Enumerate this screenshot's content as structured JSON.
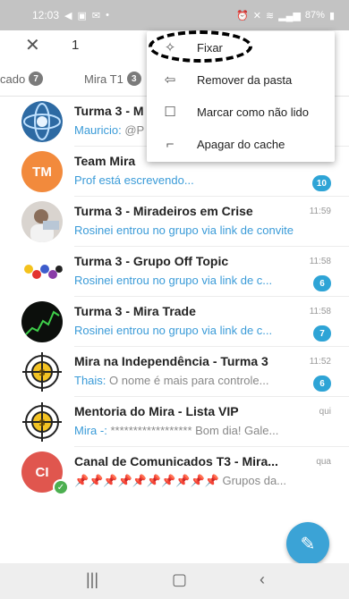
{
  "status_bar": {
    "time": "12:03",
    "left_icons": [
      "telegram-send-icon",
      "gallery-icon",
      "mail-icon",
      "dot-icon"
    ],
    "right_icons": [
      "alarm-icon",
      "mute-icon",
      "wifi-icon",
      "signal-icon"
    ],
    "battery": "87%"
  },
  "topbar": {
    "close_label": "✕",
    "selected_count": "1"
  },
  "tabs": [
    {
      "label": "cado",
      "badge": "7"
    },
    {
      "label": "Mira T1",
      "badge": "3"
    }
  ],
  "context_menu": {
    "items": [
      {
        "label": "Fixar",
        "icon": "pin-icon"
      },
      {
        "label": "Remover da pasta",
        "icon": "folder-remove-icon"
      },
      {
        "label": "Marcar como não lido",
        "icon": "mark-unread-icon"
      },
      {
        "label": "Apagar do cache",
        "icon": "broom-icon"
      }
    ]
  },
  "chats": [
    {
      "name": "Turma 3 - M",
      "sender": "Mauricio: ",
      "text": "@P",
      "time": "",
      "count": "",
      "avatar": "globe-avatar"
    },
    {
      "name": "Team Mira",
      "sender": "",
      "text": "Prof está escrevendo...",
      "time": "",
      "count": "10",
      "avatar_initials": "TM"
    },
    {
      "name": "Turma 3 - Miradeiros em Crise",
      "sender": "",
      "text": "Rosinei entrou no grupo via link de convite",
      "time": "11:59",
      "count": "",
      "avatar": "photo-avatar"
    },
    {
      "name": "Turma 3 - Grupo Off Topic",
      "sender": "",
      "text": "Rosinei entrou no grupo via link de c...",
      "time": "11:58",
      "count": "6",
      "avatar": "photo-avatar"
    },
    {
      "name": "Turma 3 - Mira Trade",
      "sender": "",
      "text": "Rosinei entrou no grupo via link de c...",
      "time": "11:58",
      "count": "7",
      "avatar": "chart-avatar"
    },
    {
      "name": "Mira na Independência - Turma 3",
      "sender": "Thais: ",
      "text": "O nome é mais para controle...",
      "time": "11:52",
      "count": "6",
      "avatar": "target-avatar"
    },
    {
      "name": "Mentoria do Mira - Lista VIP",
      "sender": "Mira -: ",
      "text": "******************  Bom dia! Gale...",
      "time": "qui",
      "count": "",
      "avatar": "target-avatar"
    },
    {
      "name": "Canal de Comunicados T3 - Mira...",
      "sender": "",
      "text": "📌📌📌📌📌📌📌📌📌📌 Grupos da...",
      "time": "qua",
      "count": "",
      "avatar_initials": "CI",
      "muted": true
    }
  ],
  "fab_icon": "pencil-icon",
  "navbar": [
    "recent-apps-icon",
    "home-icon",
    "back-icon"
  ],
  "colors": {
    "accent": "#2ea4d6",
    "status_bar": "#c3c3c3",
    "tm_avatar": "#f28a3c",
    "ci_avatar": "#e0564e"
  }
}
